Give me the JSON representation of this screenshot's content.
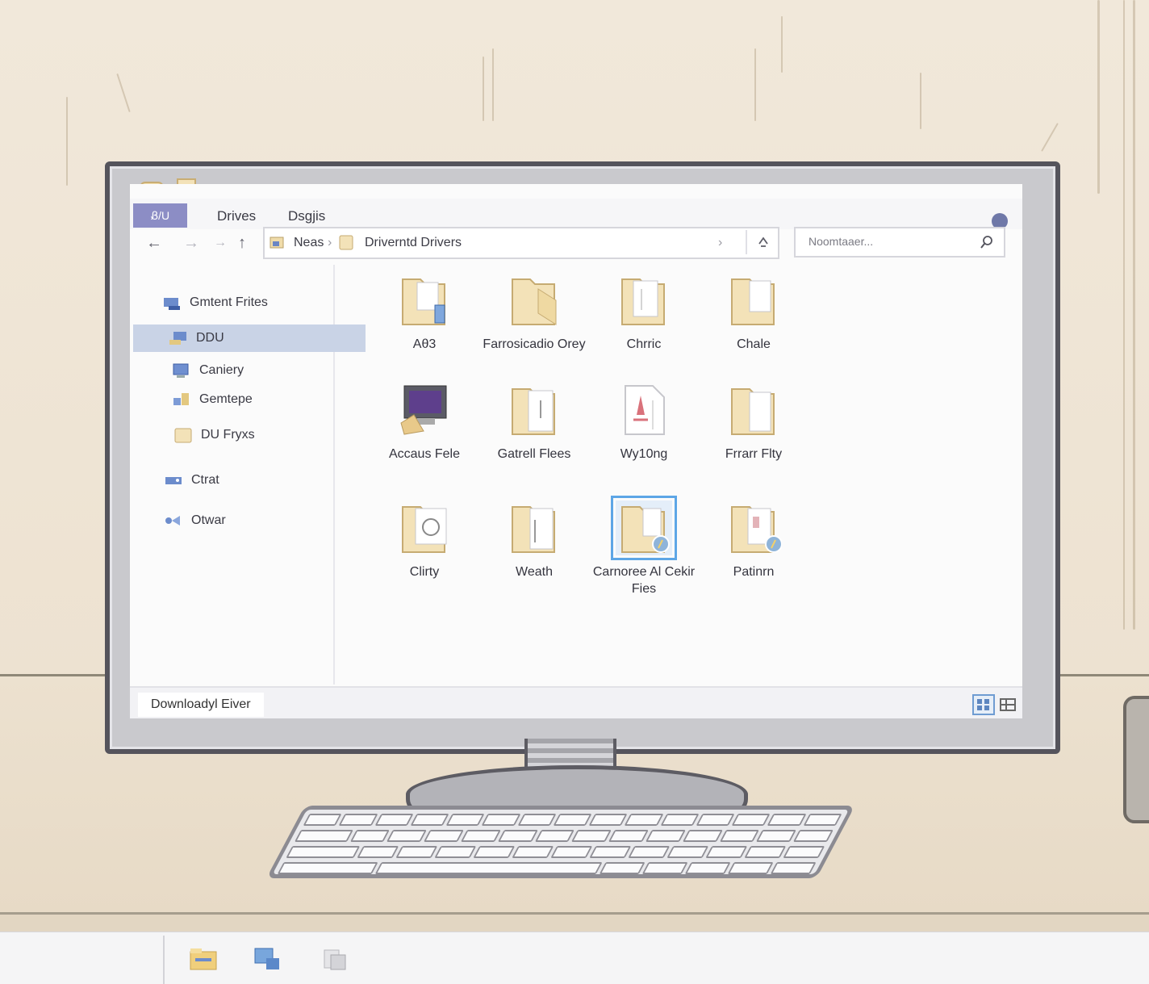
{
  "window": {
    "ribbon_tabs": [
      {
        "label": "Ᏸ/U"
      },
      {
        "label": "Drives"
      },
      {
        "label": "Dsgjis"
      }
    ]
  },
  "address_bar": {
    "segments": [
      "Neas",
      "Driverntd Drivers"
    ]
  },
  "search": {
    "placeholder": "Noomtaaer..."
  },
  "sidebar": {
    "items": [
      {
        "label": "Gmtent Frites",
        "icon": "network-drive-icon"
      },
      {
        "label": "DDU",
        "icon": "computer-icon",
        "selected": true
      },
      {
        "label": "Caniery",
        "icon": "monitor-icon"
      },
      {
        "label": "Gemtepe",
        "icon": "network-icon"
      },
      {
        "label": "DU Fryxs",
        "icon": "folder-icon"
      },
      {
        "label": "Ctrat",
        "icon": "drive-icon"
      },
      {
        "label": "Otwar",
        "icon": "share-icon"
      }
    ]
  },
  "files": [
    {
      "label": "Aθ3",
      "icon": "folder-icon"
    },
    {
      "label": "Farrosicadio Orey",
      "icon": "folder-icon"
    },
    {
      "label": "Chrric",
      "icon": "folder-icon"
    },
    {
      "label": "Chale",
      "icon": "folder-icon"
    },
    {
      "label": "Accaus Fele",
      "icon": "app-icon"
    },
    {
      "label": "Gatrell Flees",
      "icon": "folder-icon"
    },
    {
      "label": "Wy10ng",
      "icon": "document-icon"
    },
    {
      "label": "Frrarr Flty",
      "icon": "folder-icon"
    },
    {
      "label": "Clirty",
      "icon": "folder-icon"
    },
    {
      "label": "Weath",
      "icon": "folder-icon"
    },
    {
      "label": "Carnoree Al Cekir Fies",
      "icon": "folder-icon",
      "selected": true
    },
    {
      "label": "Patinrn",
      "icon": "folder-icon"
    }
  ],
  "status": {
    "text": "Downloadyl Eiver"
  },
  "colors": {
    "folder": "#f3e2b8",
    "folder_edge": "#c6ab72",
    "accent_tab": "#8c8dc5",
    "selection": "#c9d3e6",
    "selection_outline": "#5da6e6"
  }
}
